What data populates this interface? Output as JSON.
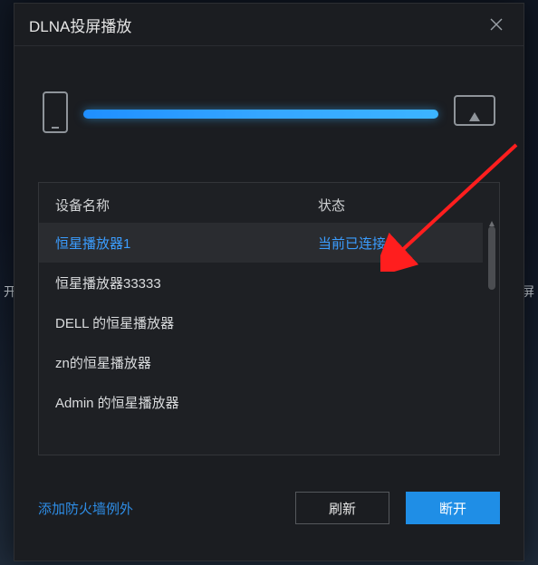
{
  "dialog": {
    "title": "DLNA投屏播放"
  },
  "backdrop": {
    "left_text": "开",
    "right_text": "屏"
  },
  "table": {
    "headers": {
      "name": "设备名称",
      "status": "状态"
    },
    "rows": [
      {
        "name": "恒星播放器1",
        "status": "当前已连接",
        "connected": true
      },
      {
        "name": "恒星播放器33333",
        "status": ""
      },
      {
        "name": "DELL 的恒星播放器",
        "status": ""
      },
      {
        "name": "zn的恒星播放器",
        "status": ""
      },
      {
        "name": "Admin 的恒星播放器",
        "status": ""
      }
    ]
  },
  "footer": {
    "firewall_link": "添加防火墙例外",
    "refresh": "刷新",
    "disconnect": "断开"
  },
  "colors": {
    "accent_blue": "#1f8ee6",
    "link_blue": "#2e8de6",
    "row_highlight": "#2a2c30"
  }
}
